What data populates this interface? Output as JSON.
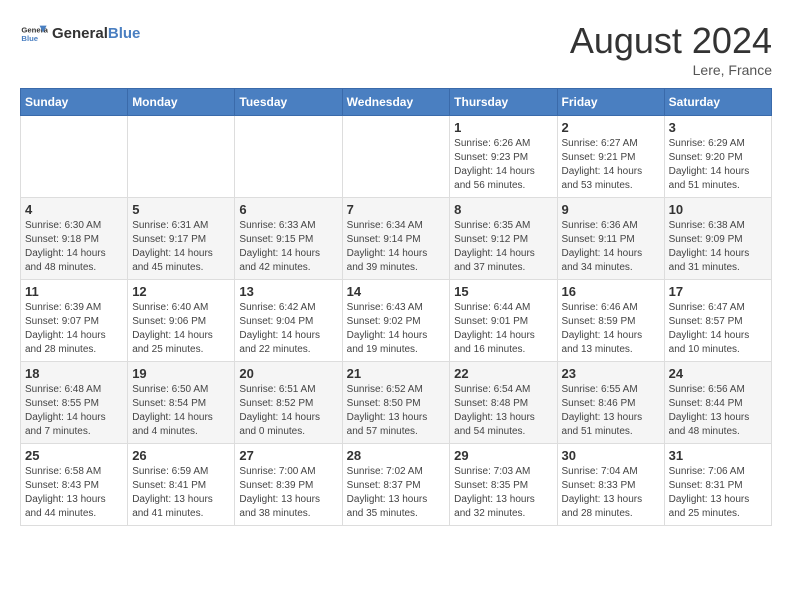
{
  "header": {
    "logo_general": "General",
    "logo_blue": "Blue",
    "month_year": "August 2024",
    "location": "Lere, France"
  },
  "days_of_week": [
    "Sunday",
    "Monday",
    "Tuesday",
    "Wednesday",
    "Thursday",
    "Friday",
    "Saturday"
  ],
  "weeks": [
    [
      {
        "day": "",
        "info": ""
      },
      {
        "day": "",
        "info": ""
      },
      {
        "day": "",
        "info": ""
      },
      {
        "day": "",
        "info": ""
      },
      {
        "day": "1",
        "info": "Sunrise: 6:26 AM\nSunset: 9:23 PM\nDaylight: 14 hours\nand 56 minutes."
      },
      {
        "day": "2",
        "info": "Sunrise: 6:27 AM\nSunset: 9:21 PM\nDaylight: 14 hours\nand 53 minutes."
      },
      {
        "day": "3",
        "info": "Sunrise: 6:29 AM\nSunset: 9:20 PM\nDaylight: 14 hours\nand 51 minutes."
      }
    ],
    [
      {
        "day": "4",
        "info": "Sunrise: 6:30 AM\nSunset: 9:18 PM\nDaylight: 14 hours\nand 48 minutes."
      },
      {
        "day": "5",
        "info": "Sunrise: 6:31 AM\nSunset: 9:17 PM\nDaylight: 14 hours\nand 45 minutes."
      },
      {
        "day": "6",
        "info": "Sunrise: 6:33 AM\nSunset: 9:15 PM\nDaylight: 14 hours\nand 42 minutes."
      },
      {
        "day": "7",
        "info": "Sunrise: 6:34 AM\nSunset: 9:14 PM\nDaylight: 14 hours\nand 39 minutes."
      },
      {
        "day": "8",
        "info": "Sunrise: 6:35 AM\nSunset: 9:12 PM\nDaylight: 14 hours\nand 37 minutes."
      },
      {
        "day": "9",
        "info": "Sunrise: 6:36 AM\nSunset: 9:11 PM\nDaylight: 14 hours\nand 34 minutes."
      },
      {
        "day": "10",
        "info": "Sunrise: 6:38 AM\nSunset: 9:09 PM\nDaylight: 14 hours\nand 31 minutes."
      }
    ],
    [
      {
        "day": "11",
        "info": "Sunrise: 6:39 AM\nSunset: 9:07 PM\nDaylight: 14 hours\nand 28 minutes."
      },
      {
        "day": "12",
        "info": "Sunrise: 6:40 AM\nSunset: 9:06 PM\nDaylight: 14 hours\nand 25 minutes."
      },
      {
        "day": "13",
        "info": "Sunrise: 6:42 AM\nSunset: 9:04 PM\nDaylight: 14 hours\nand 22 minutes."
      },
      {
        "day": "14",
        "info": "Sunrise: 6:43 AM\nSunset: 9:02 PM\nDaylight: 14 hours\nand 19 minutes."
      },
      {
        "day": "15",
        "info": "Sunrise: 6:44 AM\nSunset: 9:01 PM\nDaylight: 14 hours\nand 16 minutes."
      },
      {
        "day": "16",
        "info": "Sunrise: 6:46 AM\nSunset: 8:59 PM\nDaylight: 14 hours\nand 13 minutes."
      },
      {
        "day": "17",
        "info": "Sunrise: 6:47 AM\nSunset: 8:57 PM\nDaylight: 14 hours\nand 10 minutes."
      }
    ],
    [
      {
        "day": "18",
        "info": "Sunrise: 6:48 AM\nSunset: 8:55 PM\nDaylight: 14 hours\nand 7 minutes."
      },
      {
        "day": "19",
        "info": "Sunrise: 6:50 AM\nSunset: 8:54 PM\nDaylight: 14 hours\nand 4 minutes."
      },
      {
        "day": "20",
        "info": "Sunrise: 6:51 AM\nSunset: 8:52 PM\nDaylight: 14 hours\nand 0 minutes."
      },
      {
        "day": "21",
        "info": "Sunrise: 6:52 AM\nSunset: 8:50 PM\nDaylight: 13 hours\nand 57 minutes."
      },
      {
        "day": "22",
        "info": "Sunrise: 6:54 AM\nSunset: 8:48 PM\nDaylight: 13 hours\nand 54 minutes."
      },
      {
        "day": "23",
        "info": "Sunrise: 6:55 AM\nSunset: 8:46 PM\nDaylight: 13 hours\nand 51 minutes."
      },
      {
        "day": "24",
        "info": "Sunrise: 6:56 AM\nSunset: 8:44 PM\nDaylight: 13 hours\nand 48 minutes."
      }
    ],
    [
      {
        "day": "25",
        "info": "Sunrise: 6:58 AM\nSunset: 8:43 PM\nDaylight: 13 hours\nand 44 minutes."
      },
      {
        "day": "26",
        "info": "Sunrise: 6:59 AM\nSunset: 8:41 PM\nDaylight: 13 hours\nand 41 minutes."
      },
      {
        "day": "27",
        "info": "Sunrise: 7:00 AM\nSunset: 8:39 PM\nDaylight: 13 hours\nand 38 minutes."
      },
      {
        "day": "28",
        "info": "Sunrise: 7:02 AM\nSunset: 8:37 PM\nDaylight: 13 hours\nand 35 minutes."
      },
      {
        "day": "29",
        "info": "Sunrise: 7:03 AM\nSunset: 8:35 PM\nDaylight: 13 hours\nand 32 minutes."
      },
      {
        "day": "30",
        "info": "Sunrise: 7:04 AM\nSunset: 8:33 PM\nDaylight: 13 hours\nand 28 minutes."
      },
      {
        "day": "31",
        "info": "Sunrise: 7:06 AM\nSunset: 8:31 PM\nDaylight: 13 hours\nand 25 minutes."
      }
    ]
  ]
}
